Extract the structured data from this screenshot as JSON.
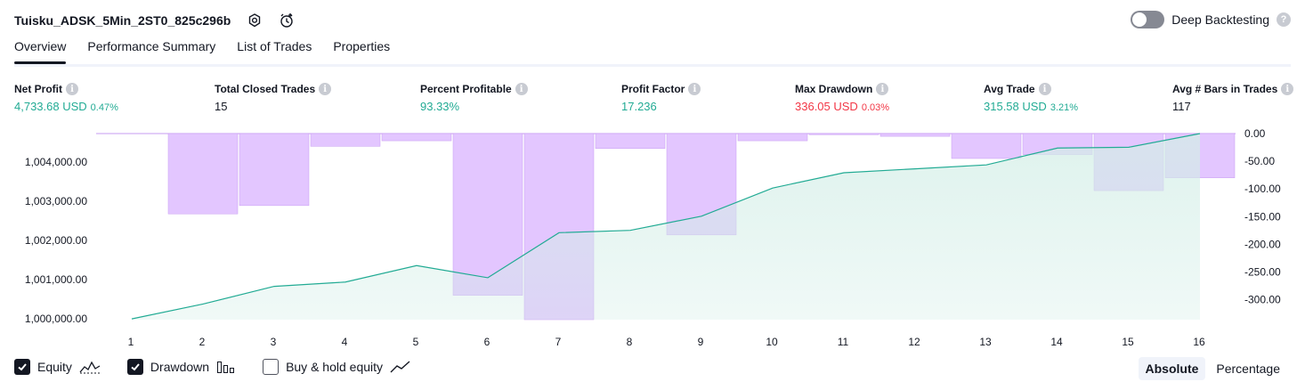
{
  "header": {
    "title": "Tuisku_ADSK_5Min_2ST0_825c296b",
    "icons": [
      "settings-icon",
      "alert-clock-icon"
    ]
  },
  "deep_backtesting": {
    "label": "Deep Backtesting",
    "enabled": false,
    "help_icon": "question-icon"
  },
  "tabs": [
    {
      "label": "Overview",
      "active": true
    },
    {
      "label": "Performance Summary",
      "active": false
    },
    {
      "label": "List of Trades",
      "active": false
    },
    {
      "label": "Properties",
      "active": false
    }
  ],
  "metrics": [
    {
      "label": "Net Profit",
      "value": "4,733.68 USD",
      "pct": "0.47%",
      "color": "#22ab94"
    },
    {
      "label": "Total Closed Trades",
      "value": "15",
      "pct": "",
      "color": "#131722"
    },
    {
      "label": "Percent Profitable",
      "value": "93.33%",
      "pct": "",
      "color": "#22ab94"
    },
    {
      "label": "Profit Factor",
      "value": "17.236",
      "pct": "",
      "color": "#22ab94"
    },
    {
      "label": "Max Drawdown",
      "value": "336.05 USD",
      "pct": "0.03%",
      "color": "#f23645"
    },
    {
      "label": "Avg Trade",
      "value": "315.58 USD",
      "pct": "3.21%",
      "color": "#22ab94"
    },
    {
      "label": "Avg # Bars in Trades",
      "value": "117",
      "pct": "",
      "color": "#131722"
    }
  ],
  "chart_data": {
    "type": "line",
    "x": [
      1,
      2,
      3,
      4,
      5,
      6,
      7,
      8,
      9,
      10,
      11,
      12,
      13,
      14,
      15,
      16
    ],
    "series": [
      {
        "type": "area",
        "values": [
          1000000,
          1000380,
          1000830,
          1000940,
          1001360,
          1001050,
          1002200,
          1002260,
          1002620,
          1003340,
          1003730,
          1003830,
          1003930,
          1004360,
          1004380,
          1004730
        ]
      },
      {
        "type": "bar",
        "values": [
          0,
          -145,
          -130,
          -23,
          -13,
          -292,
          -336,
          -27,
          -183,
          -13,
          -2,
          -5,
          -45,
          -38,
          -103,
          -80
        ]
      }
    ],
    "left_axis": {
      "ticks": [
        "1,000,000.00",
        "1,001,000.00",
        "1,002,000.00",
        "1,003,000.00",
        "1,004,000.00"
      ],
      "range": [
        999980,
        1004730
      ]
    },
    "right_axis": {
      "ticks": [
        "0.00",
        "-50.00",
        "-100.00",
        "-150.00",
        "-200.00",
        "-250.00",
        "-300.00"
      ],
      "range": [
        -336,
        0
      ]
    },
    "x_ticks": [
      "1",
      "2",
      "3",
      "4",
      "5",
      "6",
      "7",
      "8",
      "9",
      "10",
      "11",
      "12",
      "13",
      "14",
      "15",
      "16"
    ],
    "colors": {
      "equity_line": "#22ab94",
      "equity_fill": "#d3eee7",
      "drawdown": "#e1c3ff",
      "drawdown_border": "#c79bf2"
    }
  },
  "legend": [
    {
      "label": "Equity",
      "checked": true,
      "icon": "equity-line-icon"
    },
    {
      "label": "Drawdown",
      "checked": true,
      "icon": "drawdown-bars-icon"
    },
    {
      "label": "Buy & hold equity",
      "checked": false,
      "icon": "buy-hold-line-icon"
    }
  ],
  "mode": {
    "absolute": "Absolute",
    "percentage": "Percentage",
    "selected": "Absolute"
  }
}
